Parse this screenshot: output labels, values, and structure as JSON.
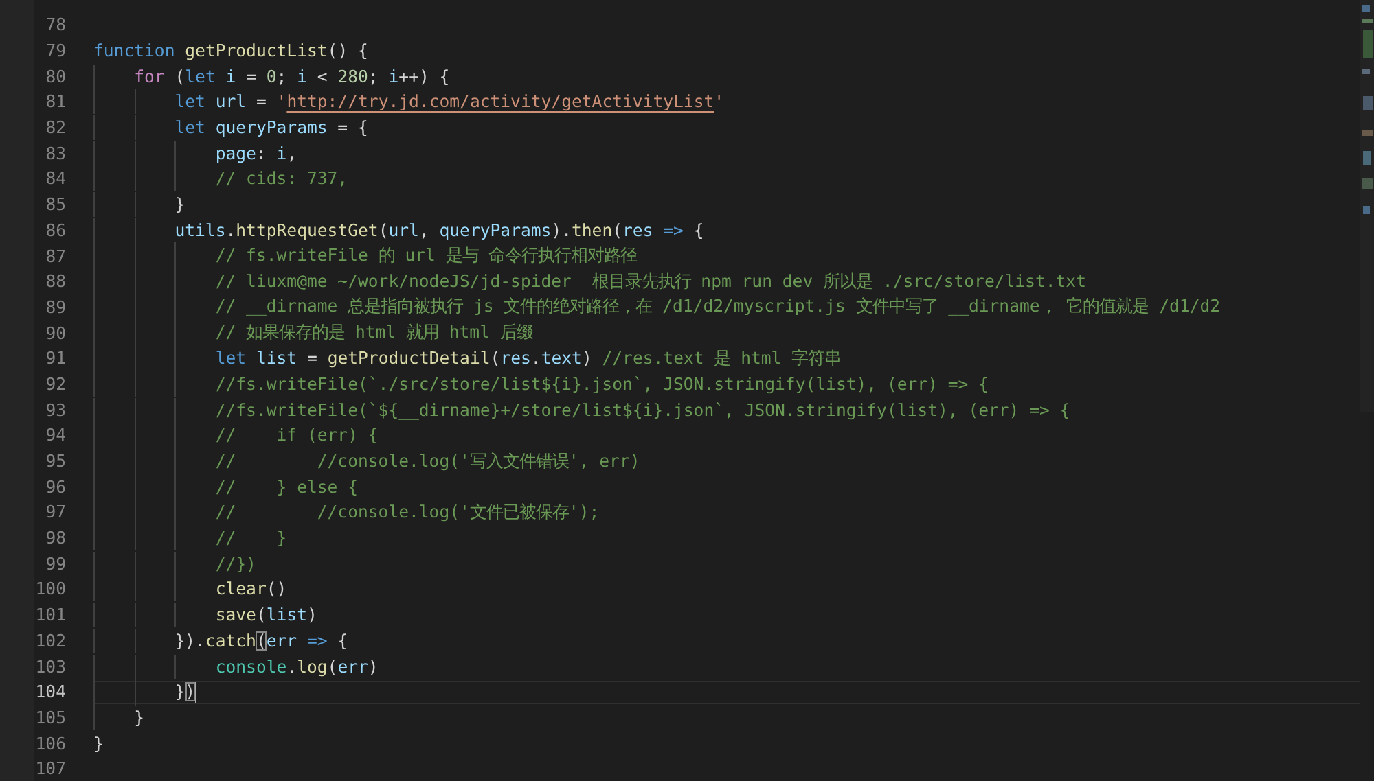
{
  "editor": {
    "lines": [
      {
        "number": "78",
        "current": false
      },
      {
        "number": "79",
        "current": false,
        "tokens": [
          {
            "kind": "keyword",
            "text": "function"
          },
          {
            "kind": "function",
            "text": " getProductList"
          },
          {
            "kind": "punct",
            "text": "() {"
          }
        ]
      },
      {
        "number": "80",
        "current": false,
        "tokens": [
          {
            "kind": "control",
            "text": "    for"
          },
          {
            "kind": "punct",
            "text": " ("
          },
          {
            "kind": "keyword",
            "text": "let"
          },
          {
            "kind": "variable",
            "text": " i"
          },
          {
            "kind": "punct",
            "text": " = "
          },
          {
            "kind": "number",
            "text": "0"
          },
          {
            "kind": "punct",
            "text": "; "
          },
          {
            "kind": "variable",
            "text": "i"
          },
          {
            "kind": "punct",
            "text": " < "
          },
          {
            "kind": "number",
            "text": "280"
          },
          {
            "kind": "punct",
            "text": "; "
          },
          {
            "kind": "variable",
            "text": "i"
          },
          {
            "kind": "punct",
            "text": "++) {"
          }
        ]
      },
      {
        "number": "81",
        "current": false,
        "tokens": [
          {
            "kind": "keyword",
            "text": "        let"
          },
          {
            "kind": "variable",
            "text": " url"
          },
          {
            "kind": "punct",
            "text": " = "
          },
          {
            "kind": "string",
            "text": "'"
          },
          {
            "kind": "url",
            "text": "http://try.jd.com/activity/getActivityList"
          },
          {
            "kind": "string",
            "text": "'"
          }
        ]
      },
      {
        "number": "82",
        "current": false,
        "tokens": [
          {
            "kind": "keyword",
            "text": "        let"
          },
          {
            "kind": "variable",
            "text": " queryParams"
          },
          {
            "kind": "punct",
            "text": " = {"
          }
        ]
      },
      {
        "number": "83",
        "current": false,
        "tokens": [
          {
            "kind": "variable",
            "text": "            page"
          },
          {
            "kind": "punct",
            "text": ": "
          },
          {
            "kind": "variable",
            "text": "i"
          },
          {
            "kind": "punct",
            "text": ","
          }
        ]
      },
      {
        "number": "84",
        "current": false,
        "tokens": [
          {
            "kind": "comment",
            "text": "            // cids: 737,"
          }
        ]
      },
      {
        "number": "85",
        "current": false,
        "tokens": [
          {
            "kind": "punct",
            "text": "        }"
          }
        ]
      },
      {
        "number": "86",
        "current": false,
        "tokens": [
          {
            "kind": "variable",
            "text": "        utils"
          },
          {
            "kind": "punct",
            "text": "."
          },
          {
            "kind": "function",
            "text": "httpRequestGet"
          },
          {
            "kind": "punct",
            "text": "("
          },
          {
            "kind": "variable",
            "text": "url"
          },
          {
            "kind": "punct",
            "text": ", "
          },
          {
            "kind": "variable",
            "text": "queryParams"
          },
          {
            "kind": "punct",
            "text": ")."
          },
          {
            "kind": "function",
            "text": "then"
          },
          {
            "kind": "punct",
            "text": "("
          },
          {
            "kind": "variable",
            "text": "res"
          },
          {
            "kind": "operator",
            "text": " =>"
          },
          {
            "kind": "punct",
            "text": " {"
          }
        ]
      },
      {
        "number": "87",
        "current": false,
        "tokens": [
          {
            "kind": "comment",
            "text": "            // fs.writeFile 的 url 是与 命令行执行相对路径"
          }
        ]
      },
      {
        "number": "88",
        "current": false,
        "tokens": [
          {
            "kind": "comment",
            "text": "            // liuxm@me ~/work/nodeJS/jd-spider  根目录先执行 npm run dev 所以是 ./src/store/list.txt"
          }
        ]
      },
      {
        "number": "89",
        "current": false,
        "tokens": [
          {
            "kind": "comment",
            "text": "            // __dirname 总是指向被执行 js 文件的绝对路径，在 /d1/d2/myscript.js 文件中写了 __dirname， 它的值就是 /d1/d2"
          }
        ]
      },
      {
        "number": "90",
        "current": false,
        "tokens": [
          {
            "kind": "comment",
            "text": "            // 如果保存的是 html 就用 html 后缀"
          }
        ]
      },
      {
        "number": "91",
        "current": false,
        "tokens": [
          {
            "kind": "keyword",
            "text": "            let"
          },
          {
            "kind": "variable",
            "text": " list"
          },
          {
            "kind": "punct",
            "text": " = "
          },
          {
            "kind": "function",
            "text": "getProductDetail"
          },
          {
            "kind": "punct",
            "text": "("
          },
          {
            "kind": "variable",
            "text": "res"
          },
          {
            "kind": "punct",
            "text": "."
          },
          {
            "kind": "variable",
            "text": "text"
          },
          {
            "kind": "punct",
            "text": ")"
          },
          {
            "kind": "comment",
            "text": " //res.text 是 html 字符串"
          }
        ]
      },
      {
        "number": "92",
        "current": false,
        "tokens": [
          {
            "kind": "comment",
            "text": "            //fs.writeFile(`./src/store/list${i}.json`, JSON.stringify(list), (err) => {"
          }
        ]
      },
      {
        "number": "93",
        "current": false,
        "tokens": [
          {
            "kind": "comment",
            "text": "            //fs.writeFile(`${__dirname}+/store/list${i}.json`, JSON.stringify(list), (err) => {"
          }
        ]
      },
      {
        "number": "94",
        "current": false,
        "tokens": [
          {
            "kind": "comment",
            "text": "            //    if (err) {"
          }
        ]
      },
      {
        "number": "95",
        "current": false,
        "tokens": [
          {
            "kind": "comment",
            "text": "            //        //console.log('写入文件错误', err)"
          }
        ]
      },
      {
        "number": "96",
        "current": false,
        "tokens": [
          {
            "kind": "comment",
            "text": "            //    } else {"
          }
        ]
      },
      {
        "number": "97",
        "current": false,
        "tokens": [
          {
            "kind": "comment",
            "text": "            //        //console.log('文件已被保存');"
          }
        ]
      },
      {
        "number": "98",
        "current": false,
        "tokens": [
          {
            "kind": "comment",
            "text": "            //    }"
          }
        ]
      },
      {
        "number": "99",
        "current": false,
        "tokens": [
          {
            "kind": "comment",
            "text": "            //})"
          }
        ]
      },
      {
        "number": "100",
        "current": false,
        "tokens": [
          {
            "kind": "function",
            "text": "            clear"
          },
          {
            "kind": "punct",
            "text": "()"
          }
        ]
      },
      {
        "number": "101",
        "current": false,
        "tokens": [
          {
            "kind": "function",
            "text": "            save"
          },
          {
            "kind": "punct",
            "text": "("
          },
          {
            "kind": "variable",
            "text": "list"
          },
          {
            "kind": "punct",
            "text": ")"
          }
        ]
      },
      {
        "number": "102",
        "current": false,
        "tokens": [
          {
            "kind": "punct",
            "text": "        })."
          },
          {
            "kind": "function",
            "text": "catch"
          },
          {
            "kind": "bracket",
            "text": "("
          },
          {
            "kind": "variable",
            "text": "err"
          },
          {
            "kind": "operator",
            "text": " =>"
          },
          {
            "kind": "punct",
            "text": " {"
          }
        ]
      },
      {
        "number": "103",
        "current": false,
        "tokens": [
          {
            "kind": "class",
            "text": "            console"
          },
          {
            "kind": "punct",
            "text": "."
          },
          {
            "kind": "function",
            "text": "log"
          },
          {
            "kind": "punct",
            "text": "("
          },
          {
            "kind": "variable",
            "text": "err"
          },
          {
            "kind": "punct",
            "text": ")"
          }
        ]
      },
      {
        "number": "104",
        "current": true,
        "tokens": [
          {
            "kind": "punct",
            "text": "        }"
          },
          {
            "kind": "bracket",
            "text": ")"
          }
        ]
      },
      {
        "number": "105",
        "current": false,
        "tokens": [
          {
            "kind": "punct",
            "text": "    }"
          }
        ]
      },
      {
        "number": "106",
        "current": false,
        "tokens": [
          {
            "kind": "punct",
            "text": "}"
          }
        ]
      },
      {
        "number": "107",
        "current": false
      }
    ]
  }
}
